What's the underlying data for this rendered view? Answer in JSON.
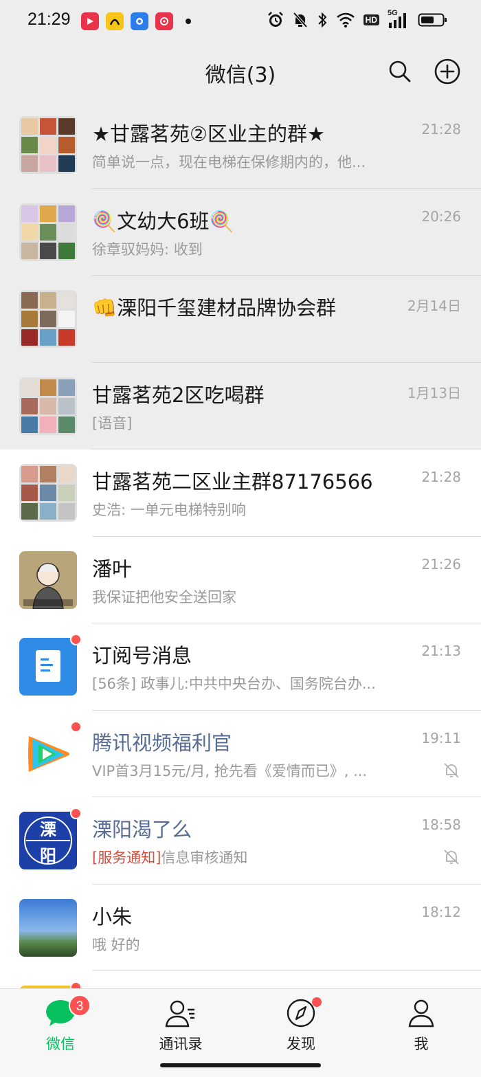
{
  "status_bar": {
    "time": "21:29",
    "network_hd": "HD",
    "network_5g": "5G"
  },
  "header": {
    "title": "微信(3)",
    "search_icon": "search-icon",
    "add_icon": "plus-circle-icon"
  },
  "chats": [
    {
      "name": "★甘露茗苑②区业主的群★",
      "preview": "简单说一点，现在电梯在保修期内的，他...",
      "time": "21:28",
      "pinned": true
    },
    {
      "name": "🍭文幼大6班🍭",
      "preview": "徐章驭妈妈: 收到",
      "time": "20:26",
      "pinned": true
    },
    {
      "name": "👊溧阳千玺建材品牌协会群",
      "preview": "",
      "time": "2月14日",
      "pinned": true
    },
    {
      "name": "甘露茗苑2区吃喝群",
      "preview": "[语音]",
      "time": "1月13日",
      "pinned": true
    },
    {
      "name": "甘露茗苑二区业主群87176566",
      "preview": "史浩: 一单元电梯特别响",
      "time": "21:28"
    },
    {
      "name": "潘叶",
      "preview": "我保证把他安全送回家",
      "time": "21:26"
    },
    {
      "name": "订阅号消息",
      "preview": "[56条] 政事儿:中共中央台办、国务院台办...",
      "time": "21:13"
    },
    {
      "name": "腾讯视频福利官",
      "preview": "VIP首3月15元/月, 抢先看《爱情而已》, ...",
      "time": "19:11"
    },
    {
      "name": "溧阳渴了么",
      "preview_tag": "[服务通知]",
      "preview": "信息审核通知",
      "time": "18:58",
      "avatar_text_top": "溧",
      "avatar_text_bottom": "阳"
    },
    {
      "name": "小朱",
      "preview": " 哦 好的",
      "time": "18:12"
    }
  ],
  "tabs": [
    {
      "label": "微信",
      "badge": "3"
    },
    {
      "label": "通讯录"
    },
    {
      "label": "发现"
    },
    {
      "label": "我"
    }
  ],
  "colors": {
    "accent_green": "#07c160",
    "official_blue": "#576b95",
    "badge_red": "#fa5151",
    "pinned_bg": "#ededed"
  }
}
